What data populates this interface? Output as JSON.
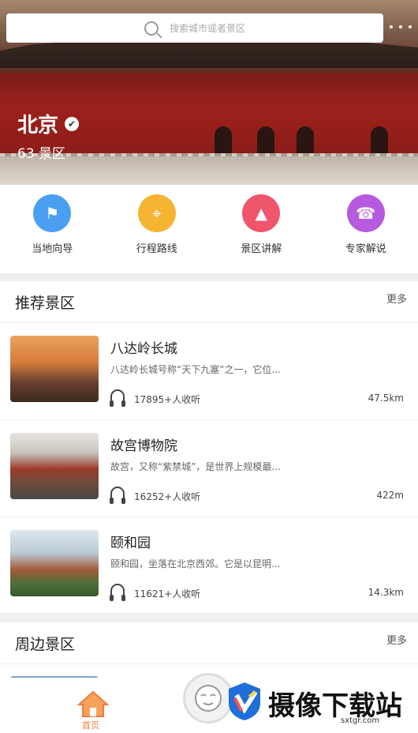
{
  "search": {
    "placeholder": "搜索城市或者景区"
  },
  "hero": {
    "city": "北京",
    "spot_count": "63 景区"
  },
  "quick_links": [
    {
      "label": "当地向导",
      "icon": "flag-icon",
      "color": "#4a9ff0"
    },
    {
      "label": "行程路线",
      "icon": "route-pin-icon",
      "color": "#f5b431"
    },
    {
      "label": "景区讲解",
      "icon": "mountain-icon",
      "color": "#f0566b"
    },
    {
      "label": "专家解说",
      "icon": "phone-icon",
      "color": "#b65be0"
    }
  ],
  "recommended": {
    "title": "推荐景区",
    "more": "更多",
    "items": [
      {
        "title": "八达岭长城",
        "desc": "八达岭长城号称“天下九塞”之一，它位...",
        "listeners": "17895+人收听",
        "distance": "47.5km"
      },
      {
        "title": "故宫博物院",
        "desc": "故宫，又称“紫禁城”，是世界上规模最...",
        "listeners": "16252+人收听",
        "distance": "422m"
      },
      {
        "title": "颐和园",
        "desc": "颐和园，坐落在北京西郊。它是以昆明...",
        "listeners": "11621+人收听",
        "distance": "14.3km"
      }
    ]
  },
  "nearby": {
    "title": "周边景区",
    "more": "更多"
  },
  "tabbar": {
    "home_label": "首页"
  },
  "watermark": {
    "name": "摄像下载站",
    "url": "sxtgr.com"
  }
}
